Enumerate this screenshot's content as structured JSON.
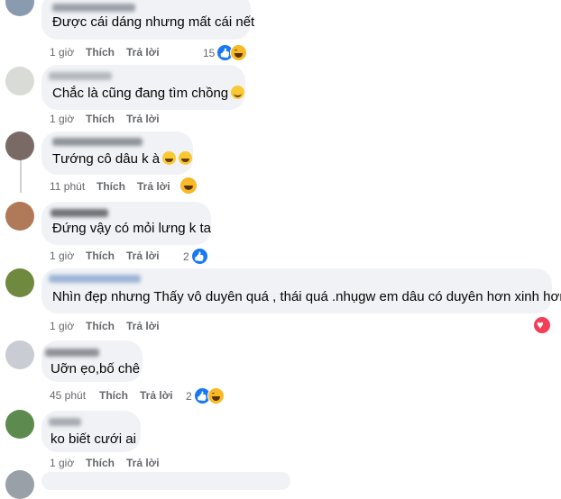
{
  "comments": [
    {
      "text": "Được cái dáng nhưng mất cái nết",
      "time": "1 giờ",
      "like": "Thích",
      "reply": "Trả lời",
      "reaction_count": "15",
      "colors": {
        "avatar": "#8a9bb0",
        "name": "#9aa0a8"
      }
    },
    {
      "text": "Chắc là cũng đang tìm chồng",
      "time": "1 giờ",
      "like": "Thích",
      "reply": "Trả lời",
      "colors": {
        "avatar": "#d9dbd6",
        "name": "#b4b8be"
      }
    },
    {
      "text": "Tướng cô dâu k à",
      "time": "11 phút",
      "like": "Thích",
      "reply": "Trả lời",
      "colors": {
        "avatar": "#7a6a66",
        "name": "#8f9399"
      }
    },
    {
      "text": "Đứng vậy có mỏi lưng k ta",
      "time": "1 giờ",
      "like": "Thích",
      "reply": "Trả lời",
      "reaction_count": "2",
      "colors": {
        "avatar": "#b07a58",
        "name": "#707277"
      }
    },
    {
      "text": "Nhìn đẹp nhưng Thấy vô duyên quá , thái quá .nhụgw em dâu có duyên hơn xinh hơn",
      "time": "1 giờ",
      "like": "Thích",
      "reply": "Trả lời",
      "colors": {
        "avatar": "#6f8a3f",
        "name": "#9cb4d6"
      }
    },
    {
      "text": "Uỡn ẹo,bố chê",
      "time": "45 phút",
      "like": "Thích",
      "reply": "Trả lời",
      "reaction_count": "2",
      "colors": {
        "avatar": "#c9ccd3",
        "name": "#8d9096"
      }
    },
    {
      "text": "ko biết cưới ai",
      "time": "1 giờ",
      "like": "Thích",
      "reply": "Trả lời",
      "colors": {
        "avatar": "#5d8a4e",
        "name": "#a7abb1"
      }
    }
  ]
}
